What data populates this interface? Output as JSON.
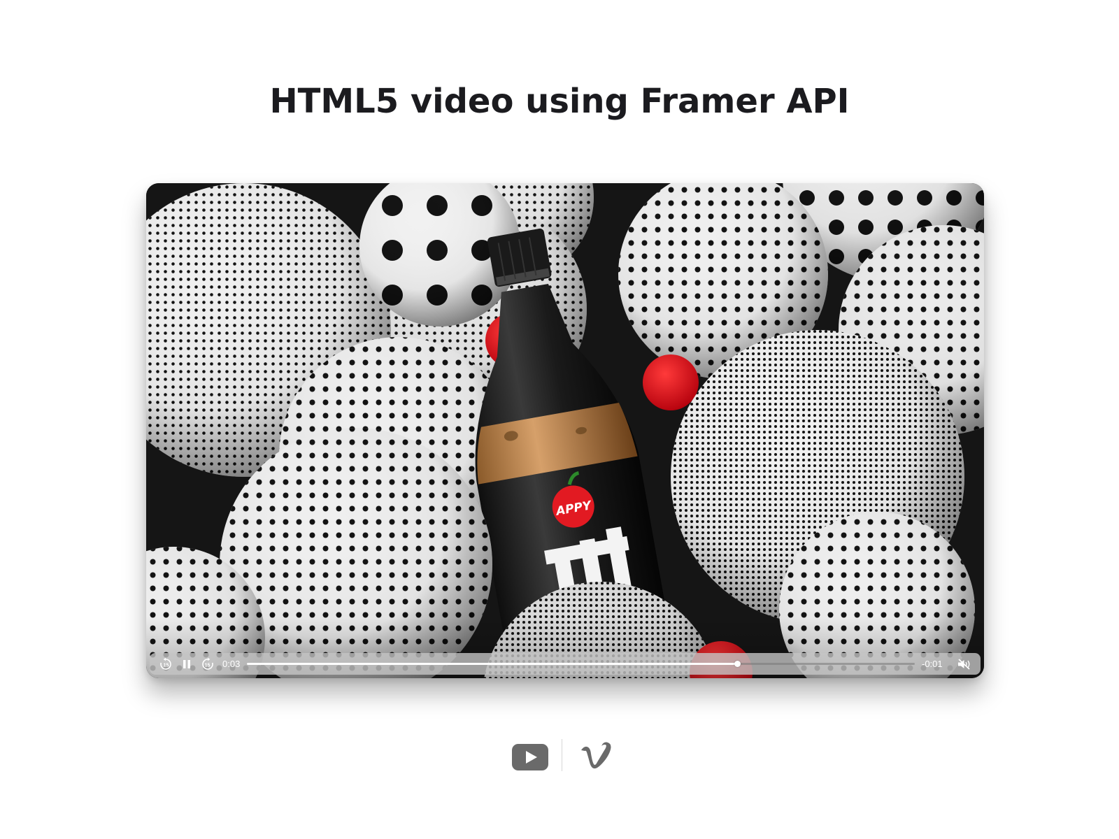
{
  "page": {
    "title": "HTML5 video using Framer API"
  },
  "video": {
    "bottle_label": "APPY",
    "controls": {
      "skip_back_seconds": "15",
      "skip_forward_seconds": "15",
      "current_time": "0:03",
      "remaining_time": "-0:01",
      "progress": 0.735,
      "state": "playing",
      "muted": true,
      "play_state_icon": "pause-icon",
      "mute_icon": "speaker-muted-icon"
    }
  },
  "providers": {
    "items": [
      {
        "icon": "youtube-icon"
      },
      {
        "icon": "vimeo-icon"
      }
    ]
  },
  "colors": {
    "title": "#1b1b1f",
    "provider_icon": "#6a6a6a",
    "accent_red": "#e4111c"
  }
}
